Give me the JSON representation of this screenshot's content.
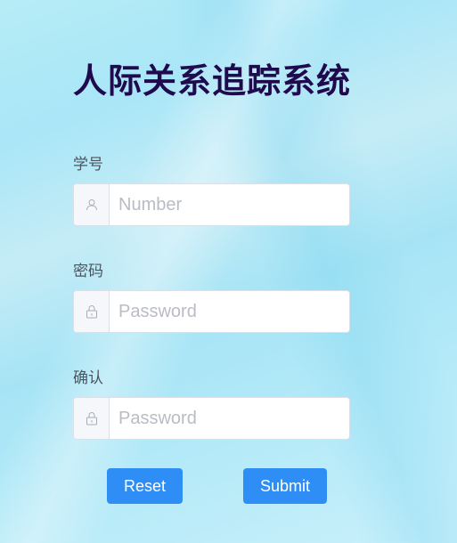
{
  "form": {
    "title": "人际关系追踪系统",
    "student_id": {
      "label": "学号",
      "placeholder": "Number",
      "value": "",
      "icon": "user-icon"
    },
    "password": {
      "label": "密码",
      "placeholder": "Password",
      "value": "",
      "icon": "lock-icon"
    },
    "confirm": {
      "label": "确认",
      "placeholder": "Password",
      "value": "",
      "icon": "lock-icon"
    },
    "reset_label": "Reset",
    "submit_label": "Submit"
  },
  "colors": {
    "title": "#1f0a4e",
    "button": "#2f8ef5",
    "label": "#4a5560",
    "placeholder": "#b8bcc4"
  }
}
